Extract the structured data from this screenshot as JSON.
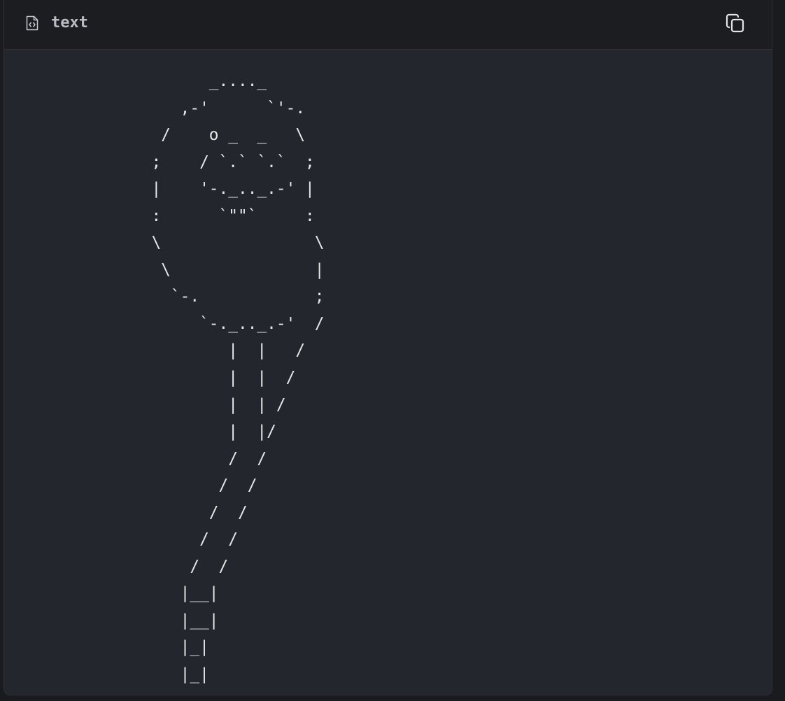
{
  "code_block": {
    "language_label": "text",
    "header_icon": "file-code-icon",
    "copy_icon": "copy-icon",
    "content": "        _...._\n     ,-'      `'-.\n   /    o _  _   \\\n  ;    / `.` `.`  ;\n  |    '-._.._.-' |\n  :      `\"\"`     :\n  \\                \\\n   \\               |\n    `-.            ;\n       `-._.._.-'  /\n          |  |   /\n          |  |  /\n          |  | /\n          |  |/\n          /  /\n         /  /\n        /  /\n       /  /\n      /  /\n     |__|\n     |__|\n     |_|\n     |_|"
  },
  "colors": {
    "page_background": "#1a1b1e",
    "header_background": "#1c1d20",
    "code_background": "#23272d",
    "label_text": "#b9bcc2",
    "code_text": "#e6e7e9",
    "icon": "#c9ccd1"
  }
}
